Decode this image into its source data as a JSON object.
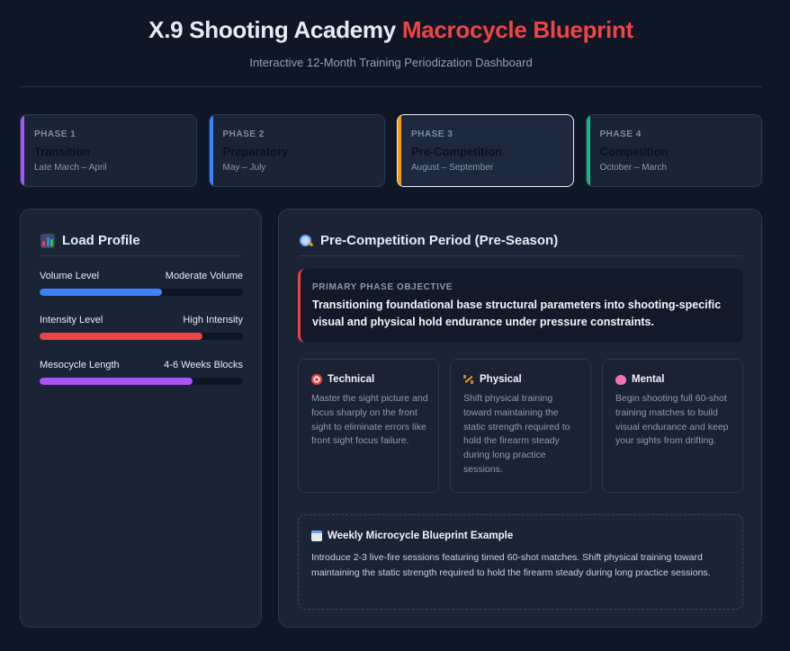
{
  "header": {
    "title_main": "X.9 Shooting Academy",
    "title_accent": "Macrocycle Blueprint",
    "subtitle": "Interactive 12-Month Training Periodization Dashboard"
  },
  "phases": [
    {
      "num": "PHASE 1",
      "name": "Transition",
      "dates": "Late March – April",
      "color": "#a855f7"
    },
    {
      "num": "PHASE 2",
      "name": "Preparatory",
      "dates": "May – July",
      "color": "#3b82f6"
    },
    {
      "num": "PHASE 3",
      "name": "Pre-Competition",
      "dates": "August – September",
      "color": "#f59e0b"
    },
    {
      "num": "PHASE 4",
      "name": "Competition",
      "dates": "October – March",
      "color": "#10b981"
    }
  ],
  "active_phase_index": 2,
  "load_profile": {
    "title": "Load Profile",
    "icon": "bar-chart-icon",
    "metrics": [
      {
        "label": "Volume Level",
        "value": "Moderate Volume",
        "fill": 0.6,
        "color": "#3b82f6"
      },
      {
        "label": "Intensity Level",
        "value": "High Intensity",
        "fill": 0.8,
        "color": "#ef4444"
      },
      {
        "label": "Mesocycle Length",
        "value": "4-6 Weeks Blocks",
        "fill": 0.75,
        "color": "#a855f7"
      }
    ]
  },
  "detail": {
    "title": "Pre-Competition Period (Pre-Season)",
    "icon": "magnifier-icon",
    "objective_label": "PRIMARY PHASE OBJECTIVE",
    "objective_text": "Transitioning foundational base structural parameters into shooting-specific visual and physical hold endurance under pressure constraints.",
    "pillars": [
      {
        "title": "Technical",
        "icon": "target-icon",
        "text": "Master the sight picture and focus sharply on the front sight to eliminate errors like front sight focus failure."
      },
      {
        "title": "Physical",
        "icon": "weightlifter-icon",
        "text": "Shift physical training toward maintaining the static strength required to hold the firearm steady during long practice sessions."
      },
      {
        "title": "Mental",
        "icon": "brain-icon",
        "text": "Begin shooting full 60-shot training matches to build visual endurance and keep your sights from drifting."
      }
    ],
    "weekly_title": "Weekly Microcycle Blueprint Example",
    "weekly_icon": "calendar-icon",
    "weekly_text": "Introduce 2-3 live-fire sessions featuring timed 60-shot matches. Shift physical training toward maintaining the static strength required to hold the firearm steady during long practice sessions."
  },
  "colors": {
    "accent": "#ef4444",
    "background": "#0f1626",
    "panel": "#1b2435"
  }
}
